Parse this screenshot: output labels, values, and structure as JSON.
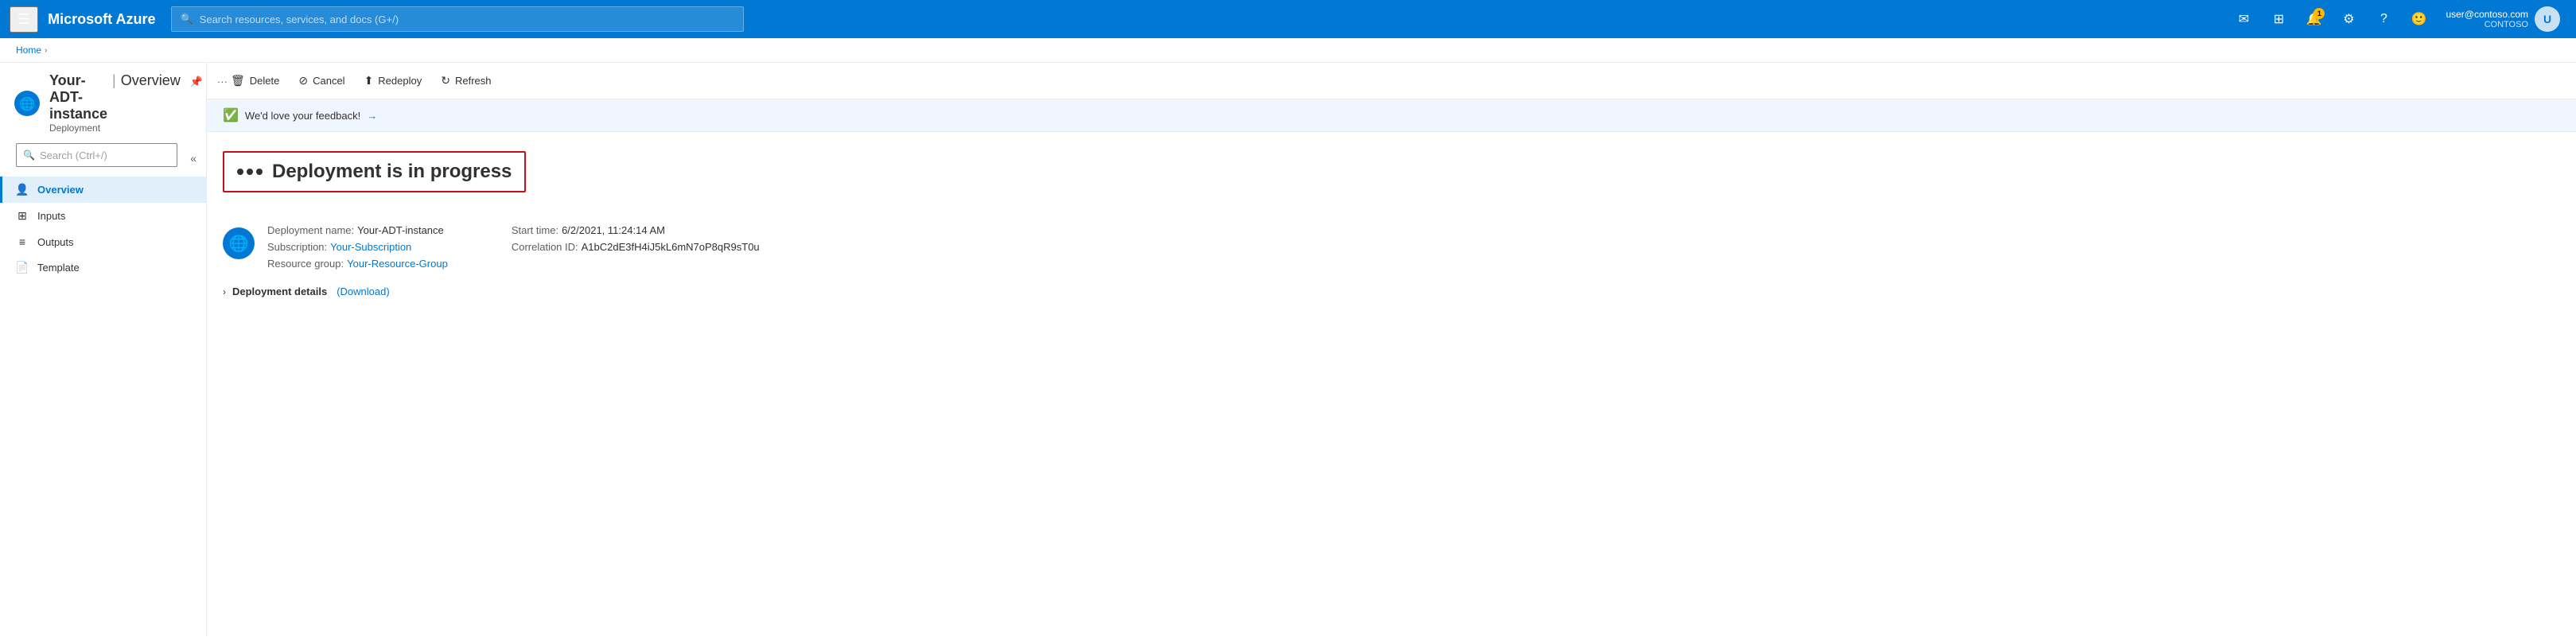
{
  "topbar": {
    "app_name": "Microsoft Azure",
    "search_placeholder": "Search resources, services, and docs (G+/)",
    "user_email": "user@contoso.com",
    "user_org": "CONTOSO",
    "notification_count": "1",
    "icons": {
      "hamburger": "☰",
      "email": "✉",
      "portal": "⊞",
      "notifications": "🔔",
      "settings": "⚙",
      "help": "?",
      "feedback": "🙂"
    }
  },
  "breadcrumb": {
    "home_label": "Home",
    "separator": "›"
  },
  "page": {
    "resource_name": "Your-ADT-instance",
    "separator": "|",
    "section": "Overview",
    "subtitle": "Deployment",
    "pin_icon": "📌",
    "more_icon": "···"
  },
  "search": {
    "placeholder": "Search (Ctrl+/)"
  },
  "toolbar": {
    "delete_label": "Delete",
    "cancel_label": "Cancel",
    "redeploy_label": "Redeploy",
    "refresh_label": "Refresh"
  },
  "feedback": {
    "text": "We'd love your feedback!",
    "arrow": "→"
  },
  "sidebar": {
    "collapse_icon": "«",
    "nav_items": [
      {
        "id": "overview",
        "label": "Overview",
        "icon": "👤",
        "active": true
      },
      {
        "id": "inputs",
        "label": "Inputs",
        "icon": "⊞",
        "active": false
      },
      {
        "id": "outputs",
        "label": "Outputs",
        "icon": "≡",
        "active": false
      },
      {
        "id": "template",
        "label": "Template",
        "icon": "📄",
        "active": false
      }
    ]
  },
  "deployment": {
    "status_dots": [
      "•",
      "•",
      "•"
    ],
    "status_text": "Deployment is in progress",
    "icon": "🌐",
    "name_label": "Deployment name:",
    "name_value": "Your-ADT-instance",
    "subscription_label": "Subscription:",
    "subscription_value": "Your-Subscription",
    "resource_group_label": "Resource group:",
    "resource_group_value": "Your-Resource-Group",
    "start_time_label": "Start time:",
    "start_time_value": "6/2/2021, 11:24:14 AM",
    "correlation_label": "Correlation ID:",
    "correlation_value": "A1bC2dE3fH4iJ5kL6mN7oP8qR9sT0u",
    "details_label": "Deployment details",
    "download_label": "(Download)"
  }
}
